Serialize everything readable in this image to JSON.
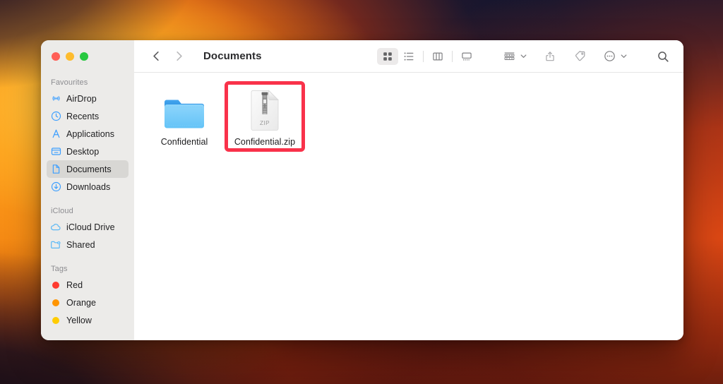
{
  "window": {
    "title": "Documents",
    "traffic_lights": [
      {
        "name": "close",
        "color": "#ff5f57"
      },
      {
        "name": "minimize",
        "color": "#febc2e"
      },
      {
        "name": "zoom",
        "color": "#28c840"
      }
    ]
  },
  "toolbar": {
    "back_icon": "chevron-left-icon",
    "forward_icon": "chevron-right-icon",
    "view_buttons": [
      {
        "name": "icon-view",
        "icon": "grid-icon",
        "active": true
      },
      {
        "name": "list-view",
        "icon": "list-icon",
        "active": false
      },
      {
        "name": "column-view",
        "icon": "column-icon",
        "active": false
      },
      {
        "name": "gallery-view",
        "icon": "gallery-icon",
        "active": false
      }
    ],
    "group_by_icon": "group-rows-icon",
    "share_icon": "share-icon",
    "tags_icon": "tag-icon",
    "more_icon": "ellipsis-circle-icon",
    "search_icon": "search-icon",
    "chevron_icon": "chevron-down-icon"
  },
  "sidebar": {
    "groups": [
      {
        "title": "Favourites",
        "items": [
          {
            "label": "AirDrop",
            "icon": "airdrop-icon",
            "selected": false
          },
          {
            "label": "Recents",
            "icon": "clock-icon",
            "selected": false
          },
          {
            "label": "Applications",
            "icon": "applications-icon",
            "selected": false
          },
          {
            "label": "Desktop",
            "icon": "desktop-icon",
            "selected": false
          },
          {
            "label": "Documents",
            "icon": "document-icon",
            "selected": true
          },
          {
            "label": "Downloads",
            "icon": "download-icon",
            "selected": false
          }
        ]
      },
      {
        "title": "iCloud",
        "items": [
          {
            "label": "iCloud Drive",
            "icon": "cloud-icon",
            "selected": false
          },
          {
            "label": "Shared",
            "icon": "shared-folder-icon",
            "selected": false
          }
        ]
      },
      {
        "title": "Tags",
        "items": [
          {
            "label": "Red",
            "icon": "tag-dot-icon",
            "color": "#ff3b30",
            "selected": false
          },
          {
            "label": "Orange",
            "icon": "tag-dot-icon",
            "color": "#ff9500",
            "selected": false
          },
          {
            "label": "Yellow",
            "icon": "tag-dot-icon",
            "color": "#ffcc00",
            "selected": false
          }
        ]
      }
    ]
  },
  "content": {
    "files": [
      {
        "name": "Confidential",
        "icon": "folder-icon",
        "highlighted": false
      },
      {
        "name": "Confidential.zip",
        "icon": "zip-icon",
        "highlighted": true,
        "badge_text": "ZIP"
      }
    ]
  },
  "colors": {
    "highlight_border": "#f9324a",
    "accent_blue": "#3b9eff",
    "sidebar_bg": "#ecebe9",
    "selected_bg": "#d8d7d4"
  }
}
